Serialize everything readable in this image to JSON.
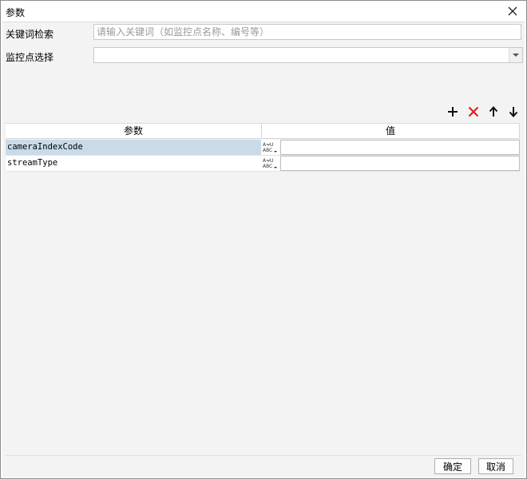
{
  "window": {
    "title": "参数"
  },
  "form": {
    "keyword_label": "关键词检索",
    "keyword_placeholder": "请输入关键词（如监控点名称、编号等）",
    "keyword_value": "",
    "camera_label": "监控点选择",
    "camera_value": ""
  },
  "toolbar": {
    "add_icon": "plus-icon",
    "delete_icon": "delete-x-icon",
    "delete_color": "#e02020",
    "up_icon": "arrow-up-icon",
    "down_icon": "arrow-down-icon"
  },
  "grid": {
    "headers": {
      "param": "参数",
      "value": "值"
    },
    "rows": [
      {
        "name": "cameraIndexCode",
        "type_icon": "abc-string-type-icon",
        "value": "",
        "selected": true
      },
      {
        "name": "streamType",
        "type_icon": "abc-string-type-icon",
        "value": "",
        "selected": false
      }
    ],
    "selection_color": "#c9dbe9"
  },
  "buttons": {
    "ok": "确定",
    "cancel": "取消"
  }
}
